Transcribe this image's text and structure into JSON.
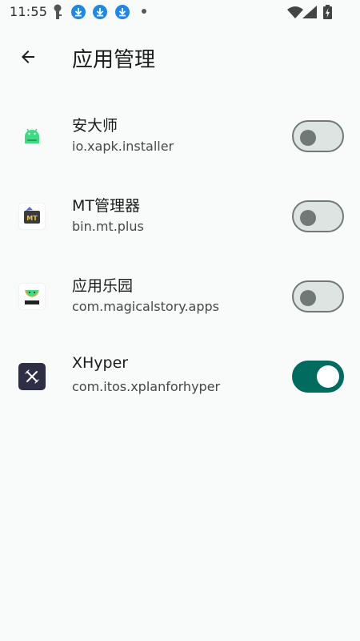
{
  "status_bar": {
    "time": "11:55",
    "icons": [
      "key-icon",
      "download-icon",
      "download-icon",
      "download-icon",
      "dot-icon",
      "wifi-icon",
      "signal-icon",
      "battery-charging-icon"
    ]
  },
  "app_bar": {
    "title": "应用管理",
    "back_icon": "arrow-back-icon"
  },
  "apps": [
    {
      "name": "安大师",
      "package": "io.xapk.installer",
      "icon": "android-robot-icon",
      "enabled": false
    },
    {
      "name": "MT管理器",
      "package": "bin.mt.plus",
      "icon": "mt-manager-icon",
      "enabled": false
    },
    {
      "name": "应用乐园",
      "package": "com.magicalstory.apps",
      "icon": "android-robot-icon",
      "enabled": false
    },
    {
      "name": "XHyper",
      "package": "com.itos.xplanforhyper",
      "icon": "xhyper-icon",
      "enabled": true
    }
  ],
  "colors": {
    "background": "#f8fbfa",
    "accent": "#006b5f",
    "toggle_off_track": "#dde4e1",
    "toggle_off_outline": "#707975",
    "status_download": "#1e88e5"
  }
}
